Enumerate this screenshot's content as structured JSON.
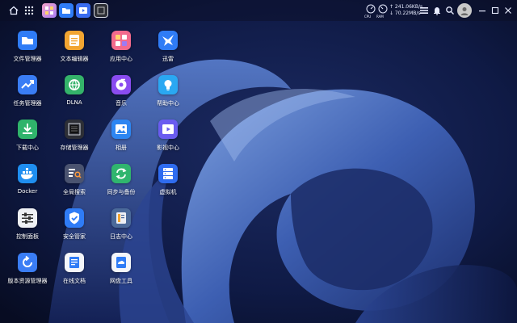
{
  "taskbar": {
    "pinned": [
      {
        "name": "app-center-icon"
      },
      {
        "name": "file-manager-icon"
      },
      {
        "name": "media-player-icon"
      },
      {
        "name": "storage-manager-icon"
      }
    ]
  },
  "system_tray": {
    "cpu_label": "CPU",
    "ram_label": "RAM",
    "upload_speed": "↑ 241.06KB/s",
    "download_speed": "↓ 70.22MB/s"
  },
  "desktop": {
    "apps": [
      {
        "label": "文件管理器",
        "icon": "folder-icon",
        "color": "#2f7cf6"
      },
      {
        "label": "任务管理器",
        "icon": "chart-trend-icon",
        "color": "#3a7df5"
      },
      {
        "label": "下载中心",
        "icon": "download-icon",
        "color": "#2fb36b"
      },
      {
        "label": "Docker",
        "icon": "docker-whale-icon",
        "color": "#1f8ef0"
      },
      {
        "label": "控制面板",
        "icon": "sliders-icon",
        "color": "#eef0f4"
      },
      {
        "label": "版本资源管理器",
        "icon": "history-icon",
        "color": "#3a7df5"
      },
      {
        "label": "文本编辑器",
        "icon": "notepad-icon",
        "color": "#f2a531"
      },
      {
        "label": "DLNA",
        "icon": "dlna-globe-icon",
        "color": "#34b36a"
      },
      {
        "label": "存储管理器",
        "icon": "storage-icon",
        "color": "#2d2f36"
      },
      {
        "label": "全局搜索",
        "icon": "search-list-icon",
        "color": "#4a5370"
      },
      {
        "label": "安全管家",
        "icon": "shield-check-icon",
        "color": "#2f7cf6"
      },
      {
        "label": "在线文档",
        "icon": "document-icon",
        "color": "#f4f6fa"
      },
      {
        "label": "应用中心",
        "icon": "app-center-icon",
        "color": "#f26a8d"
      },
      {
        "label": "音乐",
        "icon": "music-icon",
        "color": "#8a4cf0"
      },
      {
        "label": "相册",
        "icon": "photo-icon",
        "color": "#2d86f2"
      },
      {
        "label": "同步与备份",
        "icon": "sync-icon",
        "color": "#30b56e"
      },
      {
        "label": "日志中心",
        "icon": "log-icon",
        "color": "#4b6a9a"
      },
      {
        "label": "网盘工具",
        "icon": "cloud-drive-icon",
        "color": "#f4f6fa"
      },
      {
        "label": "迅雷",
        "icon": "thunder-bird-icon",
        "color": "#2f7cf6"
      },
      {
        "label": "帮助中心",
        "icon": "lightbulb-icon",
        "color": "#2aa8f2"
      },
      {
        "label": "影视中心",
        "icon": "video-icon",
        "color": "#6a5cf0"
      },
      {
        "label": "虚拟机",
        "icon": "server-icon",
        "color": "#2f6cf0"
      }
    ]
  }
}
